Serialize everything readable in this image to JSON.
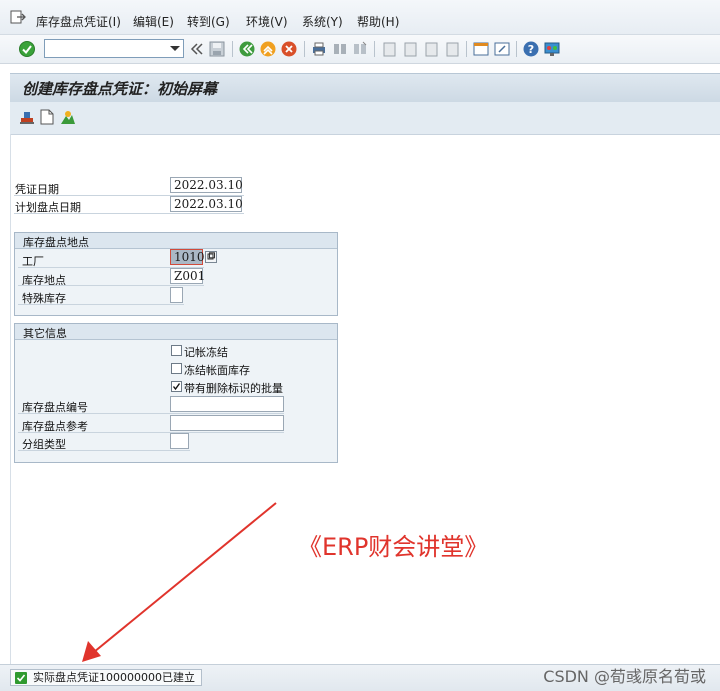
{
  "menu": {
    "items": [
      "库存盘点凭证(I)",
      "编辑(E)",
      "转到(G)",
      "环境(V)",
      "系统(Y)",
      "帮助(H)"
    ]
  },
  "toolbar": {
    "command_field_value": ""
  },
  "title": "创建库存盘点凭证：初始屏幕",
  "header_fields": {
    "document_date_label": "凭证日期",
    "document_date": "2022.03.10",
    "planned_count_date_label": "计划盘点日期",
    "planned_count_date": "2022.03.10"
  },
  "group_location": {
    "title": "库存盘点地点",
    "plant_label": "工厂",
    "plant_value": "1010",
    "storage_location_label": "库存地点",
    "storage_location_value": "Z001",
    "special_stock_label": "特殊库存",
    "special_stock_value": ""
  },
  "group_other": {
    "title": "其它信息",
    "posting_block_label": "记帐冻结",
    "posting_block_checked": false,
    "freeze_book_inv_label": "冻结帐面库存",
    "freeze_book_inv_checked": false,
    "batch_deletion_flag_label": "带有删除标识的批量",
    "batch_deletion_flag_checked": true,
    "inventory_doc_number_label": "库存盘点编号",
    "inventory_doc_number_value": "",
    "inventory_reference_label": "库存盘点参考",
    "inventory_reference_value": "",
    "grouping_type_label": "分组类型",
    "grouping_type_value": ""
  },
  "annotation_text": "《ERP财会讲堂》",
  "status_message": "实际盘点凭证100000000已建立",
  "watermark_text": "CSDN @荀彧原名荀或",
  "colors": {
    "accent_red": "#e0342c",
    "title_bar": "#d6e1ea",
    "status_green": "#2f9a2f"
  }
}
